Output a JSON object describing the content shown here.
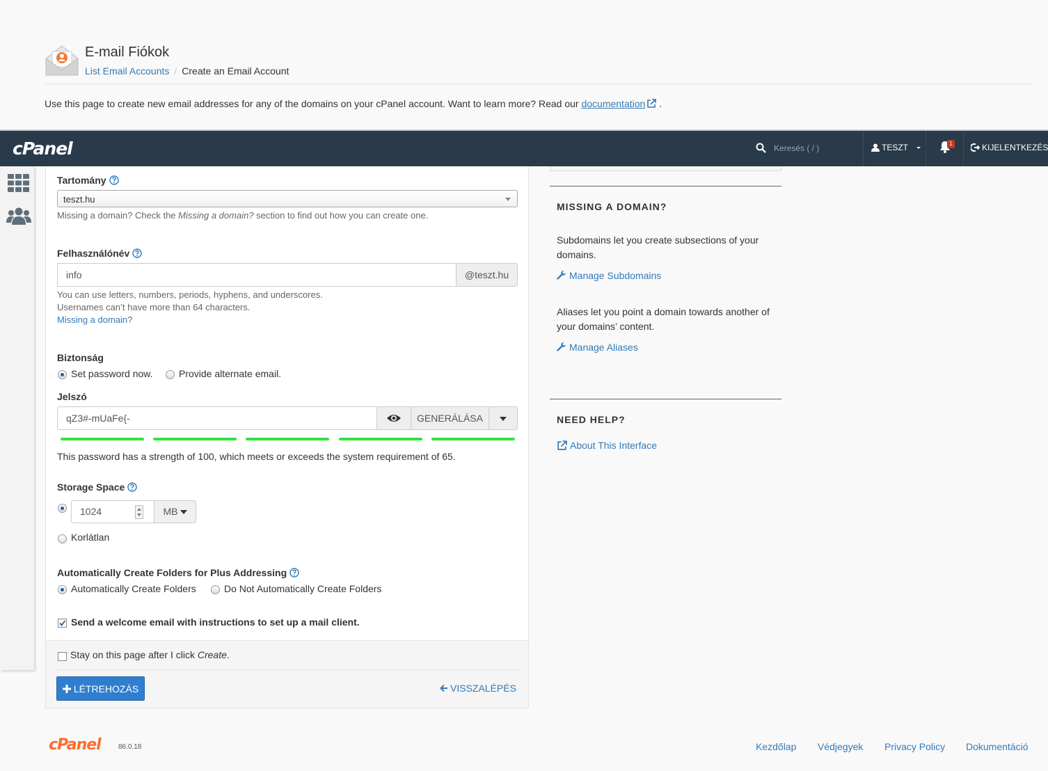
{
  "header": {
    "title": "E-mail Fiókok",
    "breadcrumb_link": "List Email Accounts",
    "breadcrumb_current": "Create an Email Account",
    "intro_text": "Use this page to create new email addresses for any of the domains on your cPanel account. Want to learn more? Read our",
    "intro_link": "documentation",
    "intro_end": "."
  },
  "topbar": {
    "brand": "cPanel",
    "search_placeholder": "Keresés ( / )",
    "user": "TESZT",
    "notifications": "1",
    "logout": "KIJELENTKEZÉS"
  },
  "form": {
    "domain_label": "Tartomány",
    "domain_value": "teszt.hu",
    "domain_hint_a": "Missing a domain? Check the ",
    "domain_hint_em": "Missing a domain?",
    "domain_hint_b": " section to find out how you can create one.",
    "username_label": "Felhasználónév",
    "username_value": "info",
    "username_suffix": "@teszt.hu",
    "username_hint_1": "You can use letters, numbers, periods, hyphens, and underscores.",
    "username_hint_2": "Usernames can’t have more than 64 characters.",
    "username_missing_link": "Missing a domain?",
    "security_label": "Biztonság",
    "security_opt_1": "Set password now.",
    "security_opt_2": "Provide alternate email.",
    "password_label": "Jelszó",
    "password_value": "qZ3#-mUaFe{-",
    "generate_label": "GENERÁLÁSA",
    "strength_text": "This password has a strength of 100, which meets or exceeds the system requirement of 65.",
    "strength_value": 100,
    "strength_color": "#34e23d",
    "storage_label": "Storage Space",
    "storage_value": "1024",
    "storage_unit": "MB",
    "storage_unlimited": "Korlátlan",
    "plus_label": "Automatically Create Folders for Plus Addressing",
    "plus_opt_1": "Automatically Create Folders",
    "plus_opt_2": "Do Not Automatically Create Folders",
    "welcome_label": "Send a welcome email with instructions to set up a mail client.",
    "stay_label_a": "Stay on this page after I click ",
    "stay_label_em": "Create",
    "stay_label_b": ".",
    "create_button": "LÉTREHOZÁS",
    "back_link": "VISSZALÉPÉS"
  },
  "right": {
    "missing_heading": "MISSING A DOMAIN?",
    "subdomains_text": "Subdomains let you create subsections of your domains.",
    "manage_subdomains": "Manage Subdomains",
    "aliases_text": "Aliases let you point a domain towards another of your domains’ content.",
    "manage_aliases": "Manage Aliases",
    "help_heading": "NEED HELP?",
    "about_link": "About This Interface"
  },
  "footer": {
    "brand": "cPanel",
    "version": "86.0.18",
    "links": [
      "Kezdőlap",
      "Védjegyek",
      "Privacy Policy",
      "Dokumentáció"
    ]
  },
  "colors": {
    "topbar": "#293a4a",
    "accent": "#337ab7",
    "brand_orange": "#ff6c2c",
    "primary_button": "#2f7ecf"
  }
}
